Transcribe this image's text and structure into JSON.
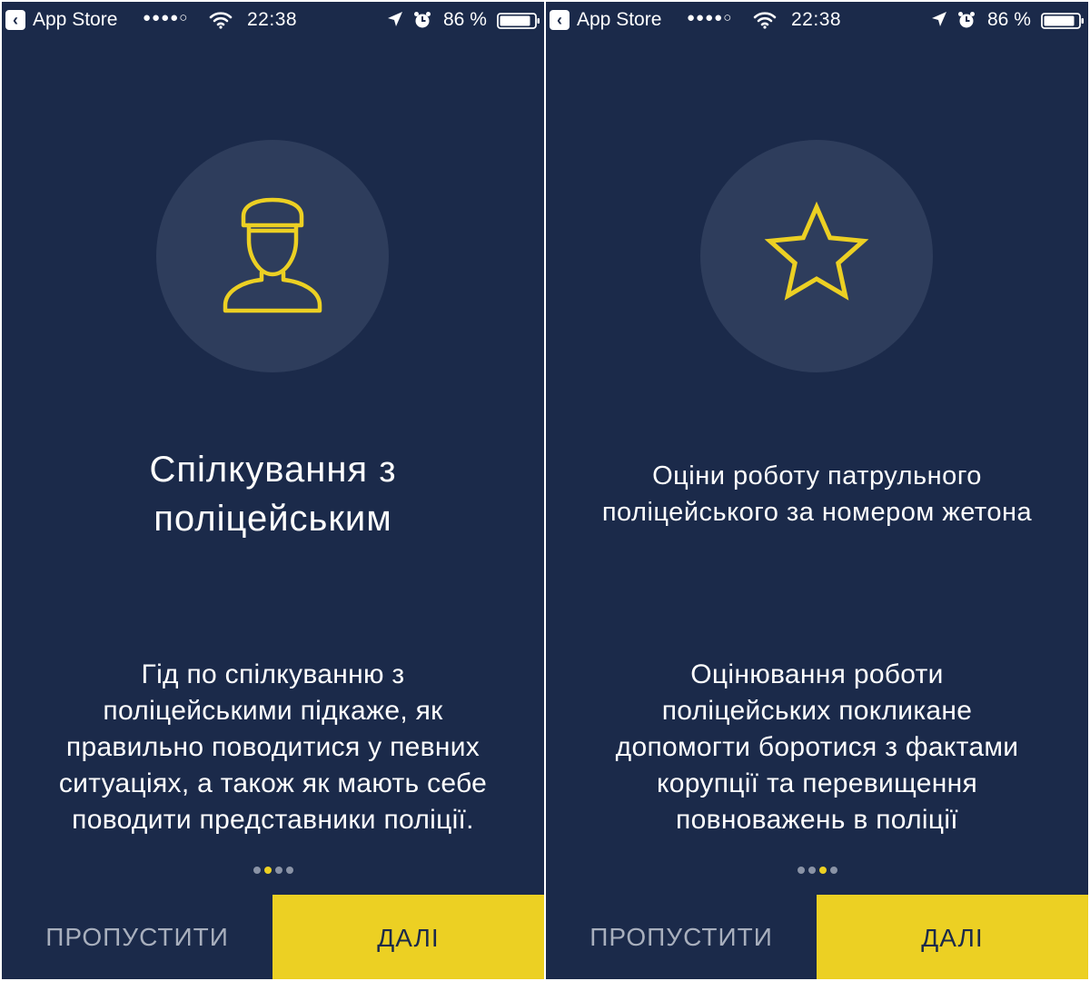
{
  "status_bar": {
    "back_label": "App Store",
    "signal": "●●●●○",
    "time": "22:38",
    "battery_percent": "86 %"
  },
  "icons": {
    "back": "chevron-left-icon",
    "wifi": "wifi-icon",
    "location": "location-arrow-icon",
    "alarm": "alarm-clock-icon",
    "battery": "battery-icon",
    "officer": "police-officer-icon",
    "star": "star-icon"
  },
  "colors": {
    "background": "#1b2a4a",
    "circle": "#2e3d5c",
    "accent": "#ecd023",
    "skip_text": "#a8afbd"
  },
  "screens": [
    {
      "title_lines": [
        "Спілкування з",
        "поліцейським"
      ],
      "description_lines": [
        "Гід по спілкуванню з",
        "поліцейськими підкаже, як",
        "правильно поводитися у певних",
        "ситуаціях, а також як мають себе",
        "поводити представники поліції."
      ],
      "page_count": 4,
      "active_page": 2,
      "skip_label": "ПРОПУСТИТИ",
      "next_label": "ДАЛІ"
    },
    {
      "title_lines": [
        "Оціни роботу патрульного",
        "поліцейського за номером жетона"
      ],
      "description_lines": [
        "Оцінювання роботи",
        "поліцейських покликане",
        "допомогти боротися з фактами",
        "корупції та перевищення",
        "повноважень в поліції"
      ],
      "page_count": 4,
      "active_page": 3,
      "skip_label": "ПРОПУСТИТИ",
      "next_label": "ДАЛІ"
    }
  ]
}
